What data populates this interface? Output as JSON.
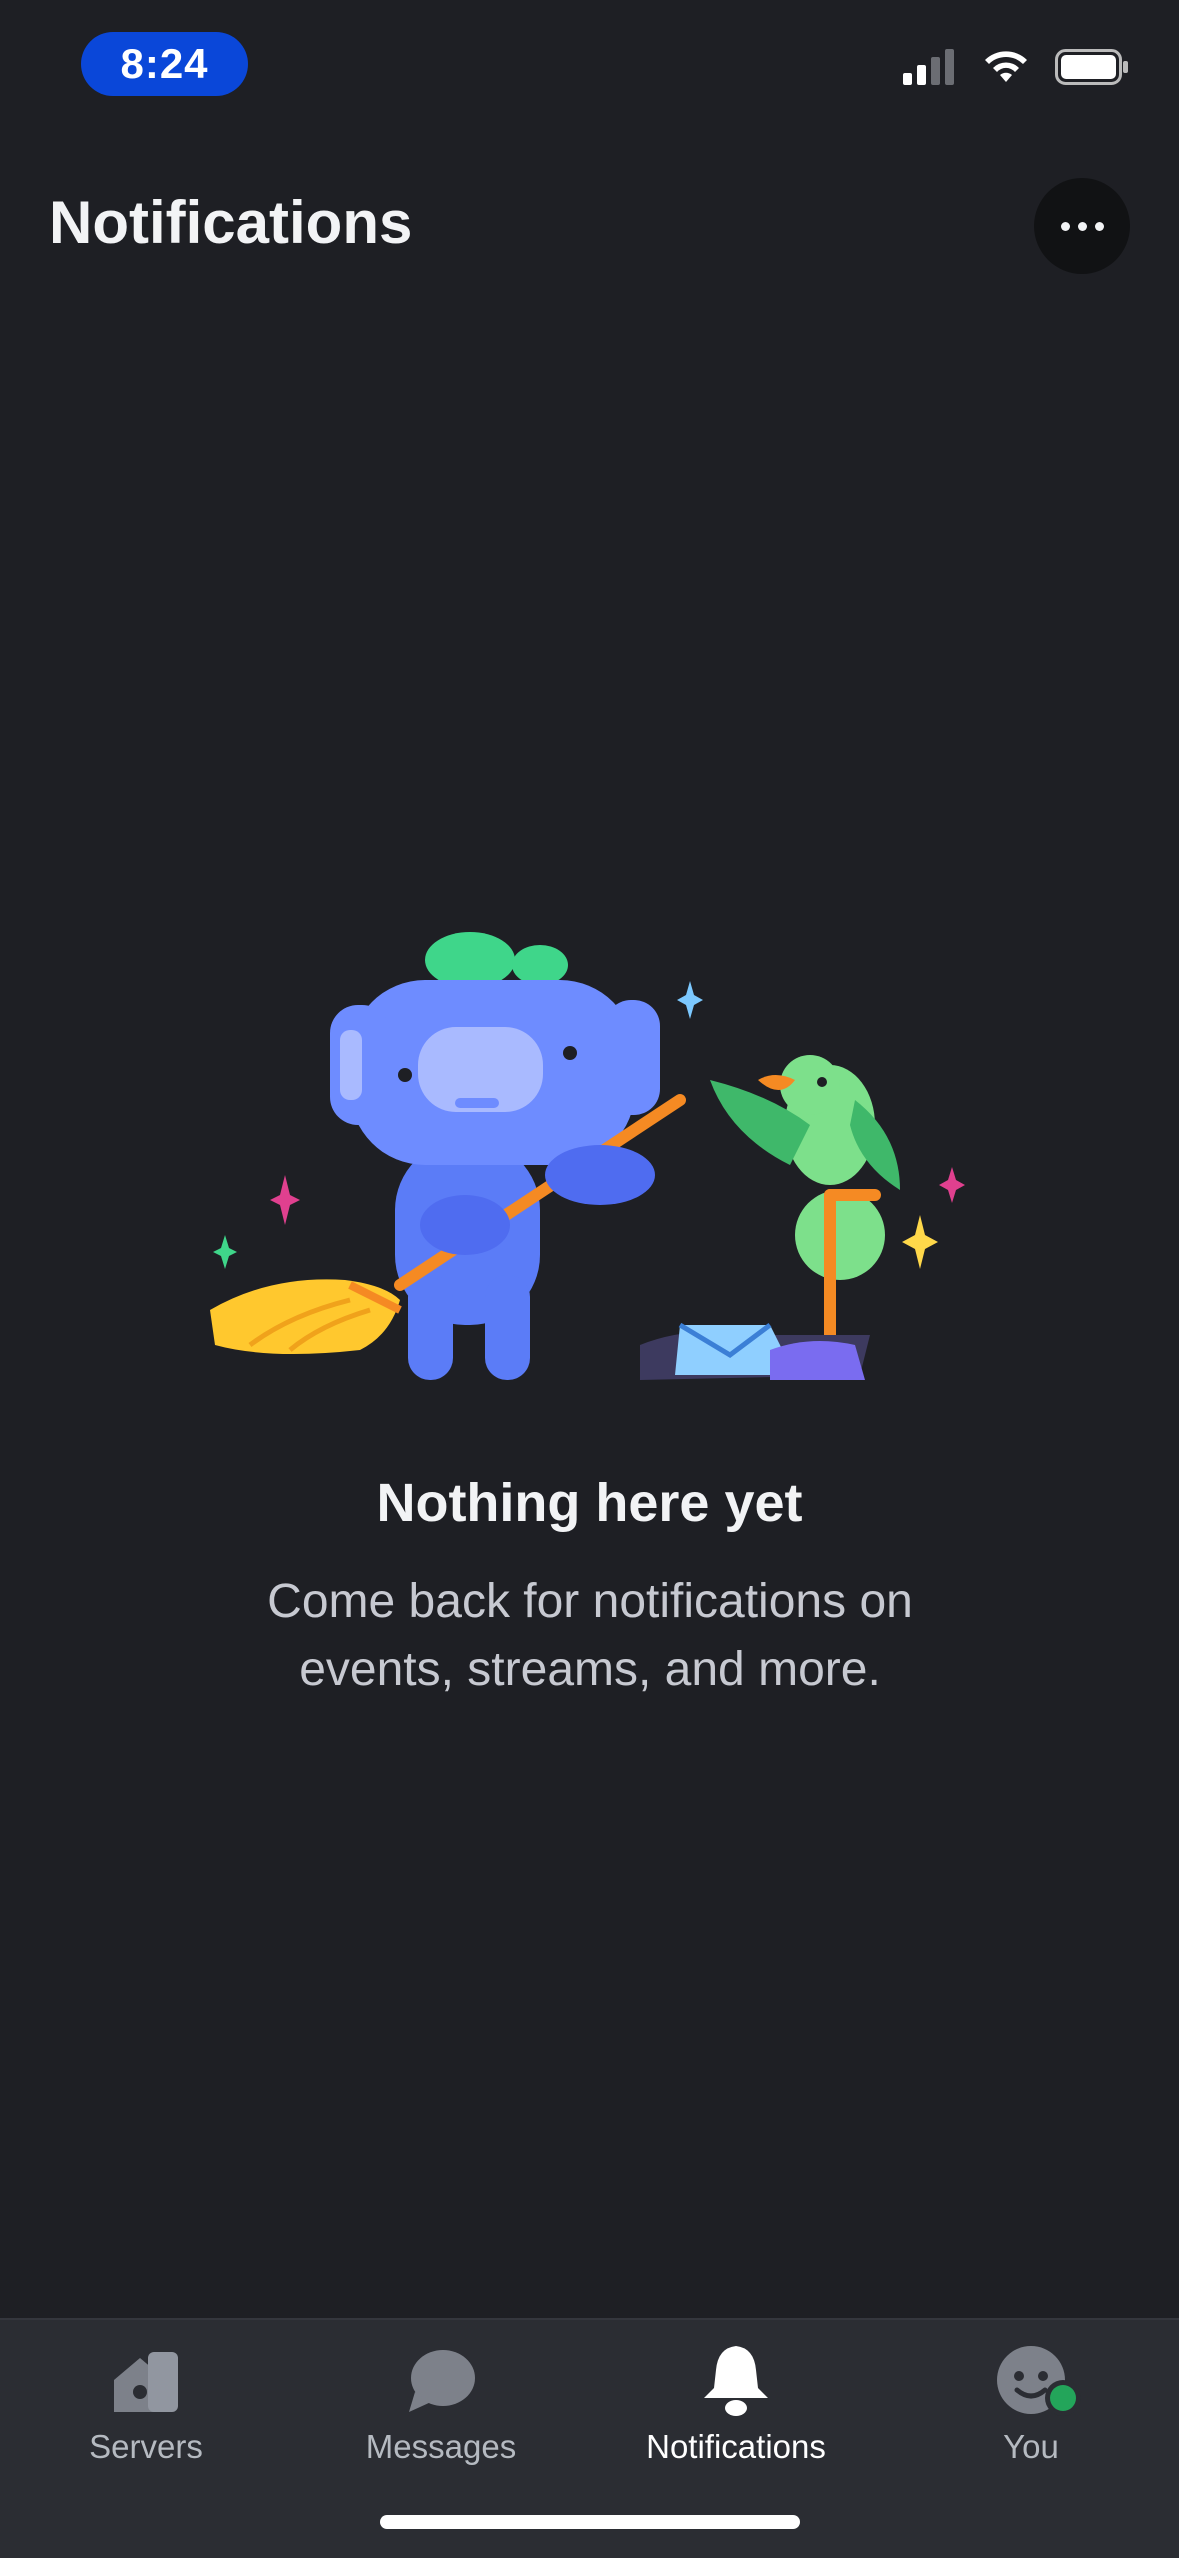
{
  "status_bar": {
    "time": "8:24",
    "icons": [
      "cellular-signal-icon",
      "wifi-icon",
      "battery-icon"
    ]
  },
  "header": {
    "title": "Notifications",
    "more_icon": "more-horizontal-icon"
  },
  "empty_state": {
    "title": "Nothing here yet",
    "body": "Come back for notifications on events, streams, and more.",
    "illustration": "wumpus-sweeping-illustration"
  },
  "tabbar": {
    "tabs": [
      {
        "label": "Servers",
        "icon": "servers-icon",
        "active": false
      },
      {
        "label": "Messages",
        "icon": "messages-icon",
        "active": false
      },
      {
        "label": "Notifications",
        "icon": "bell-icon",
        "active": true
      },
      {
        "label": "You",
        "icon": "avatar-icon",
        "active": false
      }
    ]
  },
  "colors": {
    "background": "#1e1f24",
    "tabbar": "#2b2d33",
    "time_pill": "#0a47d9",
    "online_status": "#23a55a"
  }
}
